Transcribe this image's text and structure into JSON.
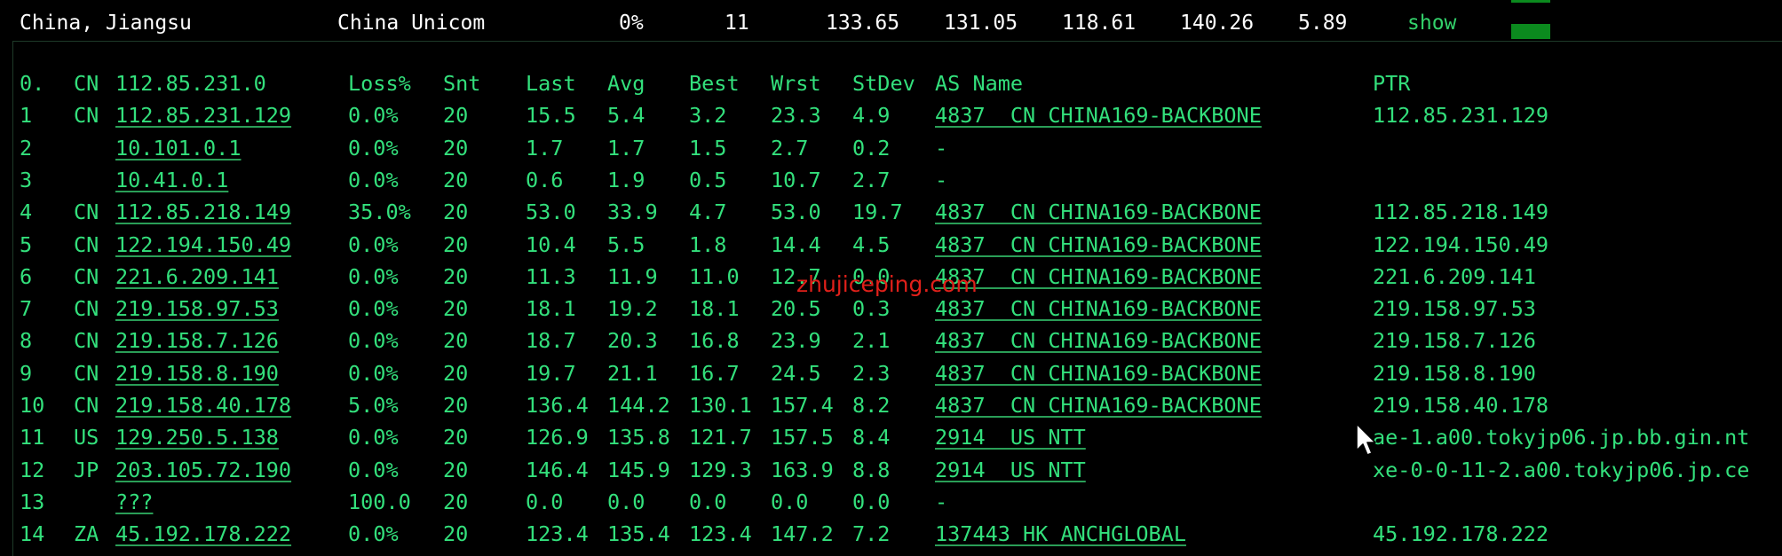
{
  "summary": {
    "location": "China, Jiangsu",
    "isp": "China Unicom",
    "loss": "0%",
    "hops": "11",
    "v1": "133.65",
    "v2": "131.05",
    "v3": "118.61",
    "v4": "140.26",
    "v5": "5.89",
    "show_label": "show"
  },
  "table": {
    "header": {
      "hop": "0.",
      "cc": "CN",
      "ip": "112.85.231.0",
      "loss": "Loss%",
      "snt": "Snt",
      "last": "Last",
      "avg": "Avg",
      "best": "Best",
      "wrst": "Wrst",
      "stdev": "StDev",
      "asname": "AS Name",
      "ptr": "PTR"
    },
    "rows": [
      {
        "hop": "1",
        "cc": "CN",
        "ip": "112.85.231.129",
        "loss": "0.0%",
        "snt": "20",
        "last": "15.5",
        "avg": "5.4",
        "best": "3.2",
        "wrst": "23.3",
        "stdev": "4.9",
        "asname": "4837  CN CHINA169-BACKBONE",
        "ptr": "112.85.231.129"
      },
      {
        "hop": "2",
        "cc": "",
        "ip": "10.101.0.1",
        "loss": "0.0%",
        "snt": "20",
        "last": "1.7",
        "avg": "1.7",
        "best": "1.5",
        "wrst": "2.7",
        "stdev": "0.2",
        "asname": "-",
        "ptr": ""
      },
      {
        "hop": "3",
        "cc": "",
        "ip": "10.41.0.1",
        "loss": "0.0%",
        "snt": "20",
        "last": "0.6",
        "avg": "1.9",
        "best": "0.5",
        "wrst": "10.7",
        "stdev": "2.7",
        "asname": "-",
        "ptr": ""
      },
      {
        "hop": "4",
        "cc": "CN",
        "ip": "112.85.218.149",
        "loss": "35.0%",
        "snt": "20",
        "last": "53.0",
        "avg": "33.9",
        "best": "4.7",
        "wrst": "53.0",
        "stdev": "19.7",
        "asname": "4837  CN CHINA169-BACKBONE",
        "ptr": "112.85.218.149"
      },
      {
        "hop": "5",
        "cc": "CN",
        "ip": "122.194.150.49",
        "loss": "0.0%",
        "snt": "20",
        "last": "10.4",
        "avg": "5.5",
        "best": "1.8",
        "wrst": "14.4",
        "stdev": "4.5",
        "asname": "4837  CN CHINA169-BACKBONE",
        "ptr": "122.194.150.49"
      },
      {
        "hop": "6",
        "cc": "CN",
        "ip": "221.6.209.141",
        "loss": "0.0%",
        "snt": "20",
        "last": "11.3",
        "avg": "11.9",
        "best": "11.0",
        "wrst": "12.7",
        "stdev": "0.0",
        "asname": "4837  CN CHINA169-BACKBONE",
        "ptr": "221.6.209.141"
      },
      {
        "hop": "7",
        "cc": "CN",
        "ip": "219.158.97.53",
        "loss": "0.0%",
        "snt": "20",
        "last": "18.1",
        "avg": "19.2",
        "best": "18.1",
        "wrst": "20.5",
        "stdev": "0.3",
        "asname": "4837  CN CHINA169-BACKBONE",
        "ptr": "219.158.97.53"
      },
      {
        "hop": "8",
        "cc": "CN",
        "ip": "219.158.7.126",
        "loss": "0.0%",
        "snt": "20",
        "last": "18.7",
        "avg": "20.3",
        "best": "16.8",
        "wrst": "23.9",
        "stdev": "2.1",
        "asname": "4837  CN CHINA169-BACKBONE",
        "ptr": "219.158.7.126"
      },
      {
        "hop": "9",
        "cc": "CN",
        "ip": "219.158.8.190",
        "loss": "0.0%",
        "snt": "20",
        "last": "19.7",
        "avg": "21.1",
        "best": "16.7",
        "wrst": "24.5",
        "stdev": "2.3",
        "asname": "4837  CN CHINA169-BACKBONE",
        "ptr": "219.158.8.190"
      },
      {
        "hop": "10",
        "cc": "CN",
        "ip": "219.158.40.178",
        "loss": "5.0%",
        "snt": "20",
        "last": "136.4",
        "avg": "144.2",
        "best": "130.1",
        "wrst": "157.4",
        "stdev": "8.2",
        "asname": "4837  CN CHINA169-BACKBONE",
        "ptr": "219.158.40.178"
      },
      {
        "hop": "11",
        "cc": "US",
        "ip": "129.250.5.138",
        "loss": "0.0%",
        "snt": "20",
        "last": "126.9",
        "avg": "135.8",
        "best": "121.7",
        "wrst": "157.5",
        "stdev": "8.4",
        "asname": "2914  US NTT",
        "ptr": "ae-1.a00.tokyjp06.jp.bb.gin.nt"
      },
      {
        "hop": "12",
        "cc": "JP",
        "ip": "203.105.72.190",
        "loss": "0.0%",
        "snt": "20",
        "last": "146.4",
        "avg": "145.9",
        "best": "129.3",
        "wrst": "163.9",
        "stdev": "8.8",
        "asname": "2914  US NTT",
        "ptr": "xe-0-0-11-2.a00.tokyjp06.jp.ce"
      },
      {
        "hop": "13",
        "cc": "",
        "ip": "???",
        "loss": "100.0",
        "snt": "20",
        "last": "0.0",
        "avg": "0.0",
        "best": "0.0",
        "wrst": "0.0",
        "stdev": "0.0",
        "asname": "-",
        "ptr": ""
      },
      {
        "hop": "14",
        "cc": "ZA",
        "ip": "45.192.178.222",
        "loss": "0.0%",
        "snt": "20",
        "last": "123.4",
        "avg": "135.4",
        "best": "123.4",
        "wrst": "147.2",
        "stdev": "7.2",
        "asname": "137443 HK ANCHGLOBAL",
        "ptr": "45.192.178.222"
      }
    ]
  },
  "watermark": "zhujiceping.com",
  "colors": {
    "background": "#000000",
    "text_green": "#33e07c",
    "summary_text": "#ffffff",
    "watermark_red": "#e0201a",
    "bar_green": "#0b8a1e"
  }
}
